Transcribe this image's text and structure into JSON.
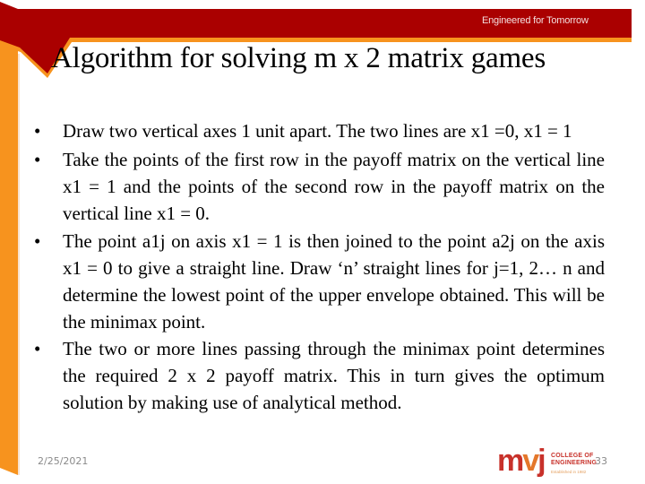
{
  "header": {
    "tagline": "Engineered for Tomorrow",
    "colors": {
      "band": "#AA0000",
      "accent": "#F7931E"
    }
  },
  "slide": {
    "title": "Algorithm for solving m x 2 matrix games",
    "bullet_glyph": "•",
    "bullets": [
      "Draw two vertical axes 1 unit apart. The two lines are x1 =0, x1 = 1",
      "Take the points of  the  first row in the payoff  matrix on the vertical  line  x1  = 1 and the points of the second row in the payoff matrix on the vertical line x1 = 0.",
      "The  point  a1j  on  axis  x1  =  1 is  then  joined to the  point a2j  on  the  axis  x1  =  0 to  give  a  straight line. Draw ‘n’ straight lines for j=1, 2… n and determine the lowest point of the upper envelope obtained. This will be the minimax point.",
      "The  two  or  more  lines  passing  through  the  minimax  point determines the required 2 x 2 payoff  matrix.  This  in  turn gives  the  optimum  solution  by  making use  of  analytical method."
    ]
  },
  "footer": {
    "date": "2/25/2021",
    "page_number": "33",
    "logo": {
      "mark_m": "m",
      "mark_v": "v",
      "mark_j": "j",
      "line1": "COLLEGE OF",
      "line2": "ENGINEERING",
      "established": "Established in 1982"
    }
  }
}
